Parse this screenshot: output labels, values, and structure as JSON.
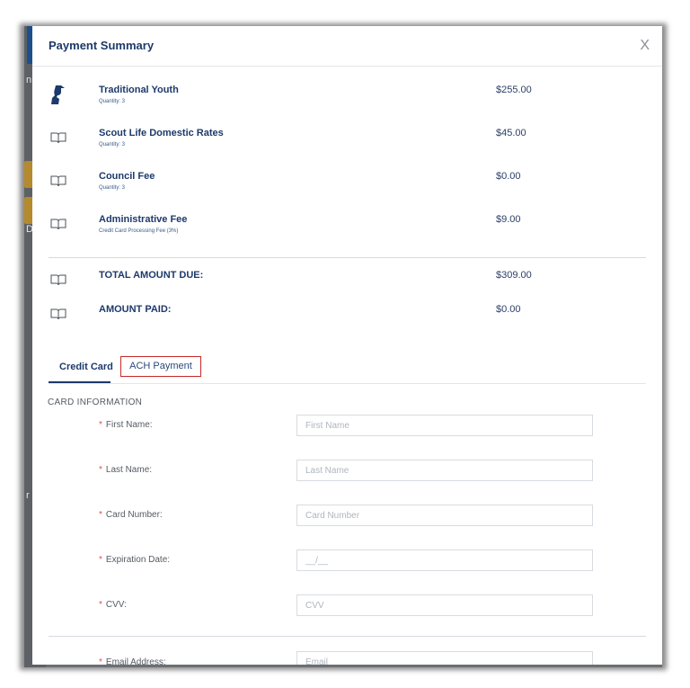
{
  "backdrop": {
    "chars": [
      "n",
      "D",
      "r"
    ]
  },
  "modal": {
    "title": "Payment Summary",
    "close_symbol": "X"
  },
  "items": [
    {
      "name": "Traditional Youth",
      "sub": "Quantity: 3",
      "price": "$255.00",
      "icon": "scout-silhouette-icon"
    },
    {
      "name": "Scout Life Domestic Rates",
      "sub": "Quantity: 3",
      "price": "$45.00",
      "icon": "book-icon"
    },
    {
      "name": "Council Fee",
      "sub": "Quantity: 3",
      "price": "$0.00",
      "icon": "book-icon"
    },
    {
      "name": "Administrative Fee",
      "sub": "Credit Card Processing Fee (3%)",
      "price": "$9.00",
      "icon": "book-icon"
    }
  ],
  "totals": [
    {
      "label": "TOTAL AMOUNT DUE:",
      "value": "$309.00",
      "icon": "book-icon"
    },
    {
      "label": "AMOUNT PAID:",
      "value": "$0.00",
      "icon": "book-icon"
    }
  ],
  "tabs": [
    {
      "label": "Credit Card",
      "active": true
    },
    {
      "label": "ACH Payment",
      "active": false,
      "highlighted": true
    }
  ],
  "card_section": {
    "title": "CARD INFORMATION"
  },
  "fields": [
    {
      "label": "First Name:",
      "placeholder": "First Name",
      "required": "*"
    },
    {
      "label": "Last Name:",
      "placeholder": "Last Name",
      "required": "*"
    },
    {
      "label": "Card Number:",
      "placeholder": "Card Number",
      "required": "*"
    },
    {
      "label": "Expiration Date:",
      "placeholder": "__/__",
      "required": "*"
    },
    {
      "label": "CVV:",
      "placeholder": "CVV",
      "required": "*"
    },
    {
      "label": "Email Address:",
      "placeholder": "Email",
      "required": "*"
    }
  ],
  "colors": {
    "brand_navy": "#1d3a6b",
    "required_red": "#d9534f",
    "highlight_red": "#c62828"
  }
}
